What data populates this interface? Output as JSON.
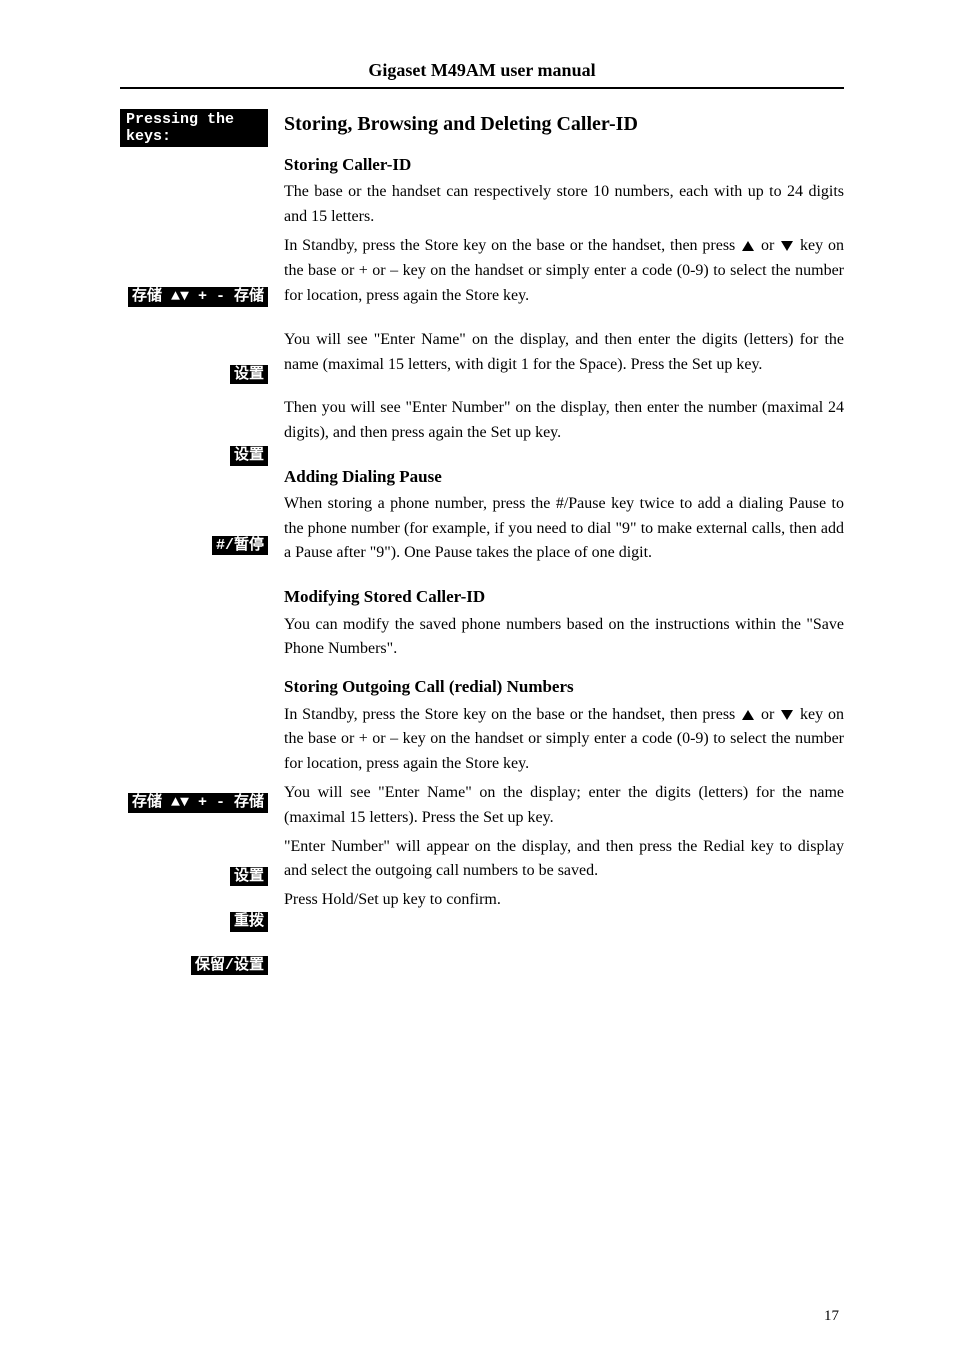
{
  "header": {
    "title": "Gigaset M49AM user manual"
  },
  "sidebar": {
    "pressing_keys": "Pressing the keys:",
    "btn_store_nav": "存储 ▲▼ + - 存储",
    "btn_setup": "设置",
    "btn_hash_pause": "#/暂停",
    "btn_redial": "重拨",
    "btn_hold_setup": "保留/设置"
  },
  "main": {
    "h1": "Storing, Browsing and Deleting Caller-ID",
    "storing_h": "Storing Caller-ID",
    "storing_p1": "The base or the handset can respectively store 10 numbers, each with up to 24 digits and 15 letters.",
    "storing_p2a": "In Standby, press the Store key on the base or the handset, then press ",
    "storing_p2_or": " or ",
    "storing_p2b": " key on the base or + or – key on the handset or simply enter a code (0-9) to select the number for location, press again the Store key.",
    "storing_p3": "You will see \"Enter Name\" on the display, and then enter the digits (letters) for the name (maximal 15 letters, with digit 1 for the Space). Press the Set up key.",
    "storing_p4": "Then you will see \"Enter Number\" on the display, then enter the number (maximal 24 digits), and then press again the Set up key.",
    "adding_h": "Adding Dialing Pause",
    "adding_p": "When storing a phone number, press the #/Pause key twice to add a dialing Pause to the phone number (for example, if you need to dial \"9\" to make external calls, then add a Pause after \"9\"). One Pause takes the place of one digit.",
    "modify_h": "Modifying Stored Caller-ID",
    "modify_p": "You can modify the saved phone numbers based on the instructions within the \"Save Phone Numbers\".",
    "outgoing_h": "Storing Outgoing Call (redial) Numbers",
    "outgoing_p1a": "In Standby, press the Store key on the base or the handset, then press ",
    "outgoing_p1_or": " or ",
    "outgoing_p1b": " key on the base or + or – key on the handset or simply enter a code (0-9) to select the number for location, press again the Store key.",
    "outgoing_p2": "You will see \"Enter Name\" on the display; enter the digits (letters) for the name (maximal 15 letters). Press the Set up key.",
    "outgoing_p3": "\"Enter Number\" will appear on the display, and then press the Redial key to display and select the outgoing call numbers to be saved.",
    "outgoing_p4": "Press Hold/Set up key to confirm."
  },
  "footer": {
    "page": "17"
  }
}
